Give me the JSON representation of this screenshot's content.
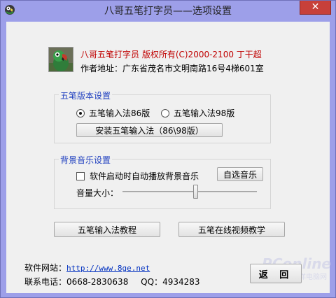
{
  "window": {
    "title": "八哥五笔打字员——选项设置",
    "close_label": "✕"
  },
  "about": {
    "line1": "八哥五笔打字员 版权所有(C)2000-2100 丁干超",
    "line2": "作者地址：广东省茂名市文明南路16号4梯601室"
  },
  "version_group": {
    "label": "五笔版本设置",
    "option_86": "五笔输入法86版",
    "option_98": "五笔输入法98版",
    "selected": "86",
    "install_button": "安装五笔输入法（86\\98版）"
  },
  "music_group": {
    "label": "背景音乐设置",
    "autoplay_label": "软件启动时自动播放背景音乐",
    "autoplay_checked": false,
    "choose_music_button": "自选音乐",
    "volume_label": "音量大小：",
    "volume_fraction": 0.54
  },
  "buttons": {
    "tutorial": "五笔输入法教程",
    "online_video": "五笔在线视频教学",
    "back": "返 回"
  },
  "footer": {
    "website_label": "软件网站：",
    "website_url": "http://www.8ge.net",
    "phone_label": "联系电话：",
    "phone": "0668-2830638",
    "qq_label": "QQ：",
    "qq": "4934283"
  },
  "watermark": {
    "brand": "PConline",
    "sub": "太平洋电脑网"
  }
}
